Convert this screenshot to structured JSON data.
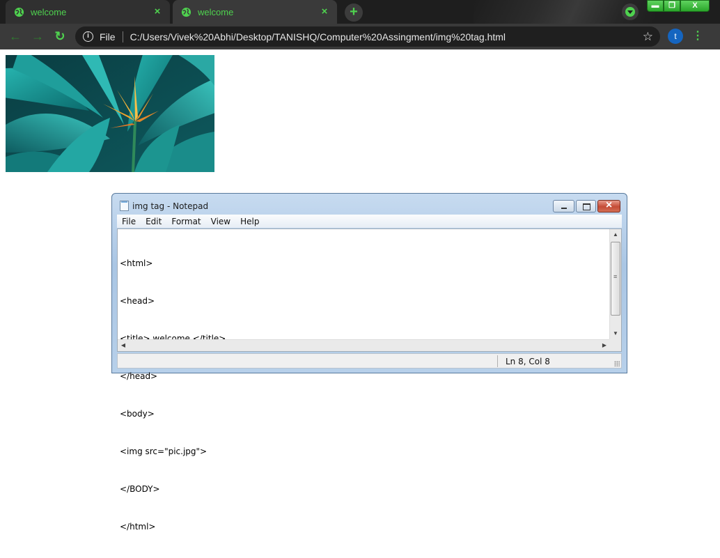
{
  "browser": {
    "tabs": [
      {
        "title": "welcome",
        "close": "×",
        "active": false
      },
      {
        "title": "welcome",
        "close": "×",
        "active": true
      }
    ],
    "new_tab": "+",
    "window_controls": {
      "minimize": "▬",
      "maximize": "❐",
      "close": "X"
    },
    "address_bar": {
      "scheme": "File",
      "url": "C:/Users/Vivek%20Abhi/Desktop/TANISHQ/Computer%20Assingment/img%20tag.html"
    },
    "avatar_letter": "t",
    "accent_color": "#4fd24f"
  },
  "page": {
    "image_description": "teal tropical leaves with orange bird-of-paradise flower"
  },
  "notepad": {
    "title": "img tag - Notepad",
    "menu": [
      "File",
      "Edit",
      "Format",
      "View",
      "Help"
    ],
    "lines": [
      "<html>",
      "<head>",
      "<title> welcome </title>",
      "</head>",
      "<body>",
      "<img src=\"pic.jpg\">",
      "</BODY>",
      "</html>"
    ],
    "status_position": "Ln 8, Col 8"
  }
}
